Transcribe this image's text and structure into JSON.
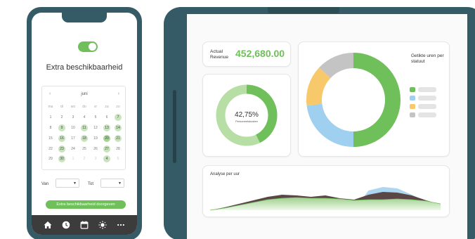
{
  "colors": {
    "frame": "#355c66",
    "accent_green": "#6fbf5a",
    "blue": "#9fd0ef",
    "yellow": "#f7c96b",
    "gray": "#c4c4c4",
    "tabbar": "#3c3c3c"
  },
  "phone": {
    "toggle_on": true,
    "title": "Extra beschikbaarheid",
    "calendar": {
      "month": "juni",
      "prev_icon": "chevron-left-icon",
      "next_icon": "chevron-right-icon",
      "weekdays": [
        "ma",
        "di",
        "wo",
        "do",
        "vr",
        "za",
        "zo"
      ],
      "days": [
        {
          "d": "1",
          "s": "n"
        },
        {
          "d": "2",
          "s": "n"
        },
        {
          "d": "3",
          "s": "n"
        },
        {
          "d": "4",
          "s": "n"
        },
        {
          "d": "5",
          "s": "n"
        },
        {
          "d": "6",
          "s": "n"
        },
        {
          "d": "7",
          "s": "av"
        },
        {
          "d": "8",
          "s": "n"
        },
        {
          "d": "9",
          "s": "av"
        },
        {
          "d": "10",
          "s": "n"
        },
        {
          "d": "11",
          "s": "av"
        },
        {
          "d": "12",
          "s": "n"
        },
        {
          "d": "13",
          "s": "av"
        },
        {
          "d": "14",
          "s": "av"
        },
        {
          "d": "15",
          "s": "n"
        },
        {
          "d": "16",
          "s": "av"
        },
        {
          "d": "17",
          "s": "n"
        },
        {
          "d": "18",
          "s": "av"
        },
        {
          "d": "19",
          "s": "n"
        },
        {
          "d": "20",
          "s": "av2"
        },
        {
          "d": "21",
          "s": "av"
        },
        {
          "d": "22",
          "s": "n"
        },
        {
          "d": "23",
          "s": "av"
        },
        {
          "d": "24",
          "s": "n"
        },
        {
          "d": "25",
          "s": "n"
        },
        {
          "d": "26",
          "s": "n"
        },
        {
          "d": "27",
          "s": "av"
        },
        {
          "d": "28",
          "s": "n"
        },
        {
          "d": "29",
          "s": "n"
        },
        {
          "d": "30",
          "s": "av"
        },
        {
          "d": "1",
          "s": "m"
        },
        {
          "d": "2",
          "s": "m"
        },
        {
          "d": "3",
          "s": "m"
        },
        {
          "d": "4",
          "s": "av"
        },
        {
          "d": "5",
          "s": "m"
        }
      ]
    },
    "from_label": "Van",
    "to_label": "Tot",
    "submit_label": "Extra beschikbaarheid doorgeven",
    "tabs": [
      "home-icon",
      "clock-icon",
      "calendar-icon",
      "sun-icon",
      "more-icon"
    ]
  },
  "tablet": {
    "revenue_label": "Actual Revenue",
    "revenue_value": "452,680.00",
    "gauge_percent": "42,75%",
    "gauge_value": 42.75,
    "gauge_label": "Personeelskosten",
    "pie_title": "Getikte uren per statuut",
    "area_title": "Analyse per uur"
  },
  "chart_data": [
    {
      "type": "pie",
      "title": "Getikte uren per statuut",
      "slices": [
        {
          "value": 50,
          "color": "#6fbf5a"
        },
        {
          "value": 23,
          "color": "#9fd0ef"
        },
        {
          "value": 14,
          "color": "#f7c96b"
        },
        {
          "value": 13,
          "color": "#c4c4c4"
        }
      ],
      "legend_position": "right"
    },
    {
      "type": "area",
      "title": "Analyse per uur",
      "x": [
        0,
        1,
        2,
        3,
        4,
        5,
        6,
        7,
        8,
        9,
        10,
        11,
        12,
        13,
        14,
        15,
        16
      ],
      "series": [
        {
          "values": [
            0,
            4,
            9,
            14,
            19,
            22,
            21,
            19,
            21,
            17,
            15,
            22,
            26,
            25,
            21,
            14,
            8
          ],
          "color": "#5b4646"
        },
        {
          "values": [
            0,
            3,
            7,
            11,
            15,
            17,
            18,
            17,
            17,
            16,
            14,
            15,
            15,
            16,
            15,
            13,
            9
          ],
          "color": "#bfe3b4"
        },
        {
          "values": [
            0,
            0,
            0,
            0,
            0,
            0,
            0,
            0,
            0,
            0,
            0,
            28,
            33,
            31,
            22,
            12,
            0
          ],
          "color": "#9fd0ef"
        }
      ]
    }
  ]
}
